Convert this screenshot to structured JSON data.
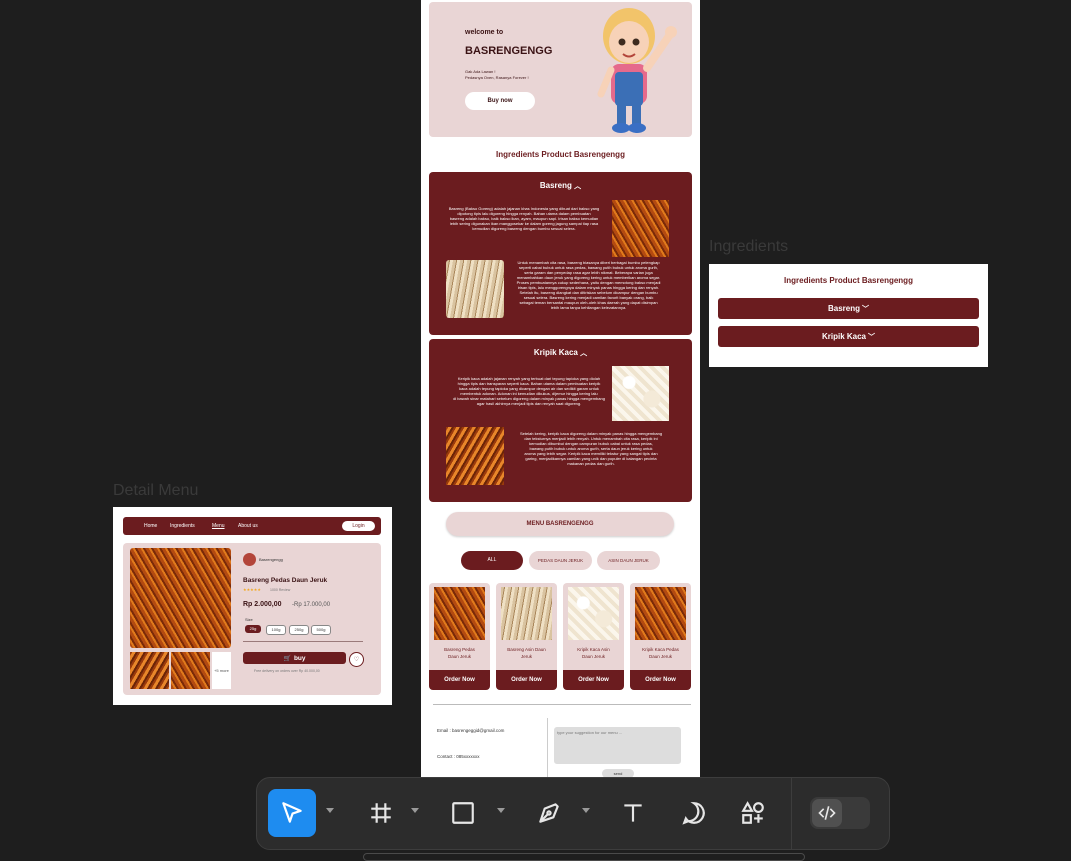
{
  "frame_labels": {
    "ingredients": "Ingredients",
    "detail_menu": "Detail Menu"
  },
  "hero": {
    "welcome": "welcome to",
    "brand": "BASRENGENGG",
    "tagline_1": "Gak Ada Lawan !",
    "tagline_2": "Pedasnya Oven, Rasanya Forever !",
    "buy_now": "Buy now"
  },
  "ingredients_section": {
    "title": "Ingredients Product Basrengengg",
    "basreng": {
      "title": "Basreng",
      "para1": [
        "Basreng (Bakso Goreng) adalah jajanan khas Indonesia yang dibuat dari bakso yang",
        "dipotong tipis lalu digoreng hingga renyah. Bahan utama dalam pembuatan",
        "basreng adalah bakso, baik bakso ikan, ayam, maupun sapi. Irisan bakso kemudian",
        "lebih sering digunakan ikan manggosekar ke dalam goreng jagung sampai tiap rasa",
        "kemudian digoreng basreng dengan bumbu sesuai selera."
      ],
      "para2": [
        "Untuk menambah cita rasa, basreng biasanya diberi berbagai bumbu pelengkap",
        "seperti cabai bubuk untuk rasa pedas, bawang putih bubuk untuk aroma gurih,",
        "serta garam dan penyedap rasa agar lebih nikmat. Beberapa varian juga",
        "menambahkan daun jeruk yang digoreng kering untuk memberikan aroma segar.",
        "Proses pembuatannya cukup sederhana, yaitu dengan memotong bakso menjadi",
        "irisan tipis, lalu menggorengnya dalam minyak panas hingga kering dan renyah.",
        "Setelah itu, basreng diangkat dan ditiriskan sebelum dicampur dengan bumbu",
        "sesuai selera. Basreng kering menjadi camilan favorit banyak orang, baik",
        "sebagai teman bersantai maupun oleh-oleh khas daerah yang dapat disimpan",
        "lebih lama tanpa kehilangan kelezatannya."
      ]
    },
    "kripik": {
      "title": "Kripik Kaca",
      "para1": [
        "Keripik kaca adalah jajanan renyah yang terbuat dari tepung tapioka yang diolah",
        "hingga tipis dan transparan seperti kaca. Bahan utama dalam pembuatan keripik",
        "kaca adalah tepung tapioka yang dicampur dengan air dan sedikit garam untuk",
        "membentuk adonan. Adonan ini kemudian dikukus, dijemur hingga kering lalu",
        "di bawah sinar matahari sebelum digoreng dalam minyak panas hingga mengembang",
        "agar hasil akhirnya menjadi tipis dan renyah saat digoreng."
      ],
      "para2": [
        "Setelah kering, keripik kaca digoreng dalam minyak panas hingga mengembang",
        "dan teksturnya menjadi lebih renyah. Untuk menambah cita rasa, keripik ini",
        "kemudian dibumbui dengan campuran bubuk cabai untuk rasa pedas,",
        "bawang putih bubuk untuk aroma gurih, serta daun jeruk kering untuk",
        "aroma yang lebih segar. Keripik kaca memiliki tekstur yang sangat tipis dan",
        "garing, menjadikannya camilan yang unik dan populer di kalangan pecinta",
        "makanan pedas dan gurih."
      ]
    }
  },
  "menu_section": {
    "title": "MENU BASRENGENGG",
    "filters": [
      "ALL",
      "PEDAS DAUN JERUK",
      "ASIN DAUN JERUK"
    ],
    "products": [
      {
        "name_1": "Basreng Pedas",
        "name_2": "Daun Jeruk",
        "order": "Order Now",
        "image": "fried-image"
      },
      {
        "name_1": "Basreng Asin Daun",
        "name_2": "Jeruk",
        "order": "Order Now",
        "image": "sticks-image"
      },
      {
        "name_1": "Kripik Kaca Asin",
        "name_2": "Daun Jeruk",
        "order": "Order Now",
        "image": "crackers-image"
      },
      {
        "name_1": "Kripik Kaca Pedas",
        "name_2": "Daun Jeruk",
        "order": "Order Now",
        "image": "fried-image"
      }
    ]
  },
  "footer": {
    "email": "Email : basrengeggid@gmail.com",
    "contact": "Contact : 085xxxxxxx",
    "suggestion_placeholder": "type your suggestion for our menu ...",
    "send": "send"
  },
  "ingredients_collapsed": {
    "title": "Ingredients Product Basrengengg",
    "items": [
      "Basreng",
      "Kripik Kaca"
    ]
  },
  "detail_menu": {
    "nav": [
      "Home",
      "Ingredients",
      "Menu",
      "About us"
    ],
    "login": "Login",
    "store": "Basrengengg",
    "product_title": "Basreng Pedas Daun Jeruk",
    "stars": "★★★★★",
    "reviews": "1000 Review",
    "price": "Rp 2.000,00",
    "old_price": "-Rp 17.000,00",
    "size_label": "Size",
    "sizes": [
      "25g",
      "100g",
      "250g",
      "500g"
    ],
    "buy": "buy",
    "delivery": "Free delivery on orders over Rp 40.000,00",
    "more_photos": "+5 more"
  },
  "toolbar": {
    "tools": [
      "move-tool",
      "frame-tool",
      "rectangle-tool",
      "pen-tool",
      "text-tool",
      "comment-tool",
      "assets-tool"
    ],
    "dev_mode": "dev-mode"
  },
  "colors": {
    "maroon": "#6b1c1f",
    "pink": "#e9d5d5",
    "tool_active": "#1e8cf0",
    "canvas": "#1e1e1e"
  }
}
